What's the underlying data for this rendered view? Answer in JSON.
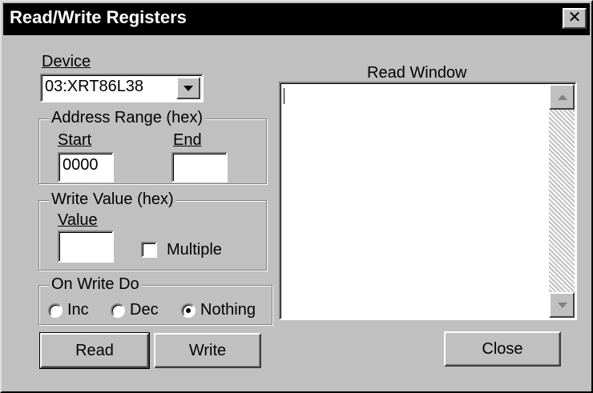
{
  "window": {
    "title": "Read/Write Registers",
    "close_glyph": "✕"
  },
  "device": {
    "label": "Device",
    "selected": "03:XRT86L38"
  },
  "address_range": {
    "label": "Address Range (hex)",
    "start_label": "Start",
    "start_value": "0000",
    "end_label": "End",
    "end_value": ""
  },
  "write_value": {
    "label": "Write Value (hex)",
    "value_label": "Value",
    "value": "",
    "multiple_label": "Multiple",
    "multiple_checked": false
  },
  "on_write": {
    "label": "On Write Do",
    "options": [
      "Inc",
      "Dec",
      "Nothing"
    ],
    "selected": "Nothing"
  },
  "read_window": {
    "label": "Read Window",
    "content": ""
  },
  "buttons": {
    "read": "Read",
    "write": "Write",
    "close": "Close"
  },
  "icons": {
    "dropdown": "chevron-down-icon",
    "scroll_up": "scroll-up-arrow-icon",
    "scroll_down": "scroll-down-arrow-icon",
    "window_close": "close-icon"
  },
  "colors": {
    "face": "#c0c0c0",
    "titlebar": "#000000",
    "title_text": "#ffffff"
  }
}
